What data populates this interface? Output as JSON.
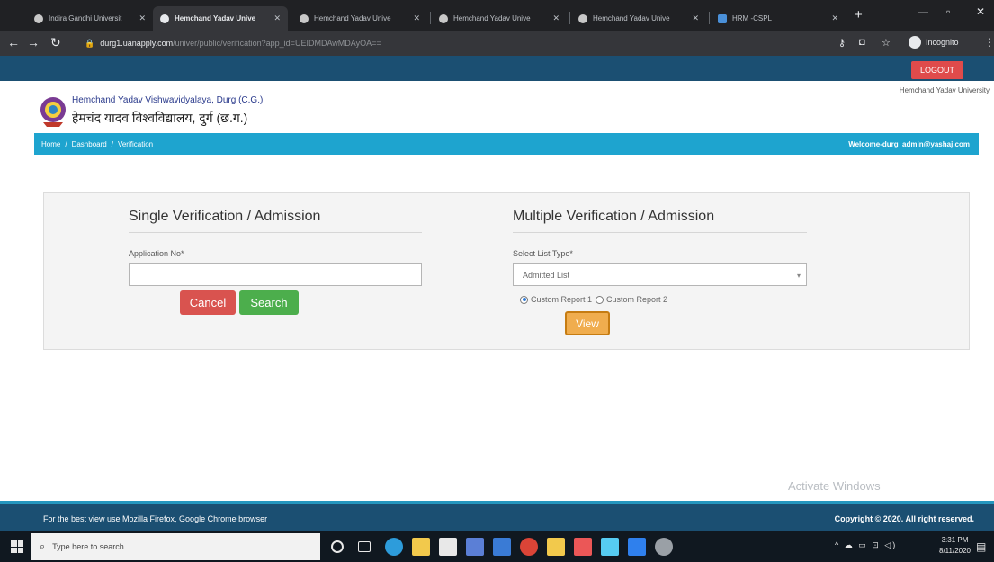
{
  "browser": {
    "tabs": [
      {
        "label": "Indira Gandhi Universit",
        "active": false
      },
      {
        "label": "Hemchand Yadav Unive",
        "active": true
      },
      {
        "label": "Hemchand Yadav Unive",
        "active": false
      },
      {
        "label": "Hemchand Yadav Unive",
        "active": false
      },
      {
        "label": "Hemchand Yadav Unive",
        "active": false
      },
      {
        "label": "HRM -CSPL",
        "active": false
      }
    ],
    "url_host": "durg1.uanapply.com",
    "url_path": "/univer/public/verification?app_id=UEIDMDAwMDAyOA==",
    "incognito_label": "Incognito"
  },
  "site": {
    "logout_label": "LOGOUT",
    "university_name_en": "Hemchand Yadav Vishwavidyalaya, Durg (C.G.)",
    "university_name_hi": "हेमचंद यादव विश्वविद्यालय, दुर्ग (छ.ग.)",
    "university_name_right": "Hemchand Yadav University",
    "breadcrumb": [
      "Home",
      "/",
      "Dashboard",
      "/",
      "Verification"
    ],
    "welcome_text": "Welcome-durg_admin@yashaj.com"
  },
  "single": {
    "title": "Single Verification / Admission",
    "field_label": "Application No*",
    "field_value": "",
    "cancel_label": "Cancel",
    "search_label": "Search"
  },
  "multiple": {
    "title": "Multiple Verification / Admission",
    "select_label": "Select List Type*",
    "select_value": "Admitted List",
    "radio1_label": "Custom Report 1",
    "radio2_label": "Custom Report 2",
    "view_label": "View"
  },
  "watermark": "Activate Windows",
  "footer": {
    "left": "For the best view use Mozilla Firefox, Google Chrome browser",
    "right": "Copyright © 2020. All right reserved."
  },
  "taskbar": {
    "search_placeholder": "Type here to search",
    "time": "3:31 PM",
    "date": "8/11/2020"
  }
}
